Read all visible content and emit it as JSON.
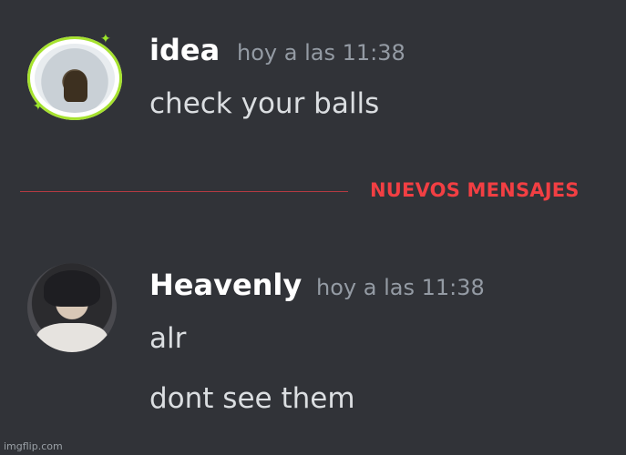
{
  "messages": [
    {
      "author": "idea",
      "timestamp": "hoy a las 11:38",
      "lines": [
        "check your balls"
      ],
      "avatar_icon": "avatar-idea",
      "avatar_ring_color": "#a6e22e"
    },
    {
      "author": "Heavenly",
      "timestamp": "hoy a las 11:38",
      "lines": [
        "alr",
        "dont see them"
      ],
      "avatar_icon": "avatar-heavenly"
    }
  ],
  "new_messages_divider": {
    "label": "NUEVOS MENSAJES",
    "color": "#f23f43"
  },
  "watermark": "imgflip.com",
  "colors": {
    "background": "#313338",
    "author": "#ffffff",
    "timestamp": "#949ba4",
    "message_text": "#dbdee1"
  }
}
